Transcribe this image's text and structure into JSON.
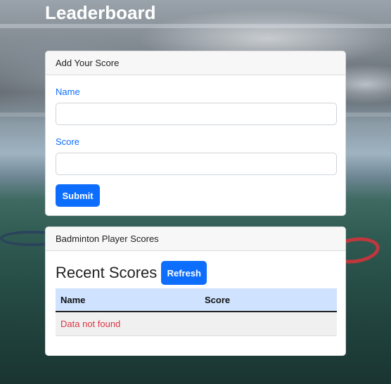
{
  "page": {
    "title": "Leaderboard"
  },
  "add_score_card": {
    "header": "Add Your Score",
    "name_label": "Name",
    "name_value": "",
    "score_label": "Score",
    "score_value": "",
    "submit_label": "Submit"
  },
  "scores_card": {
    "header": "Badminton Player Scores",
    "heading": "Recent Scores",
    "refresh_label": "Refresh",
    "table": {
      "columns": [
        "Name",
        "Score"
      ],
      "empty_message": "Data not found"
    }
  },
  "colors": {
    "primary": "#0d6efd",
    "table_header": "#cfe2ff",
    "error_text": "#dc3545"
  }
}
